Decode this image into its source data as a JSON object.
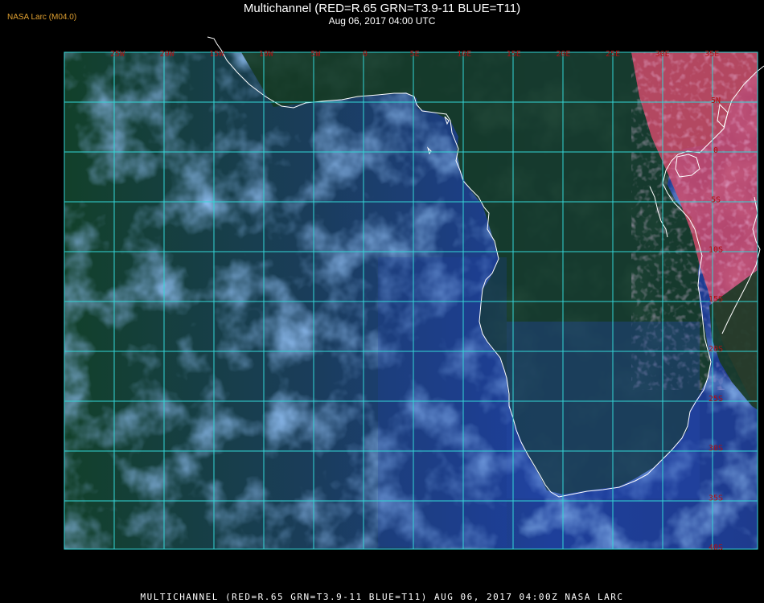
{
  "header": {
    "title": "Multichannel (RED=R.65 GRN=T3.9-11 BLUE=T11)",
    "datetime": "Aug 06, 2017 04:00 UTC",
    "organization": "NASA Larc (M04.0)"
  },
  "footer": {
    "caption": "MULTICHANNEL (RED=R.65 GRN=T3.9-11 BLUE=T11) AUG 06, 2017 04:00Z   NASA LARC"
  },
  "map": {
    "longitude_labels": [
      "25W",
      "20W",
      "15W",
      "10W",
      "5W",
      "0",
      "5E",
      "10E",
      "15E",
      "20E",
      "25E",
      "30E",
      "35E"
    ],
    "latitude_labels": [
      "5N",
      "0",
      "5S",
      "10S",
      "15S",
      "20S",
      "25S",
      "30S",
      "35S",
      "40S"
    ],
    "colors": {
      "grid": "#33d6d6",
      "coastline": "#ffffff",
      "labels": "#b01010",
      "ocean": "#1f3f9c",
      "clear_land_dark": "#163a1e",
      "land_hot": "#d04860",
      "cloud": "#4a8ff0"
    }
  }
}
